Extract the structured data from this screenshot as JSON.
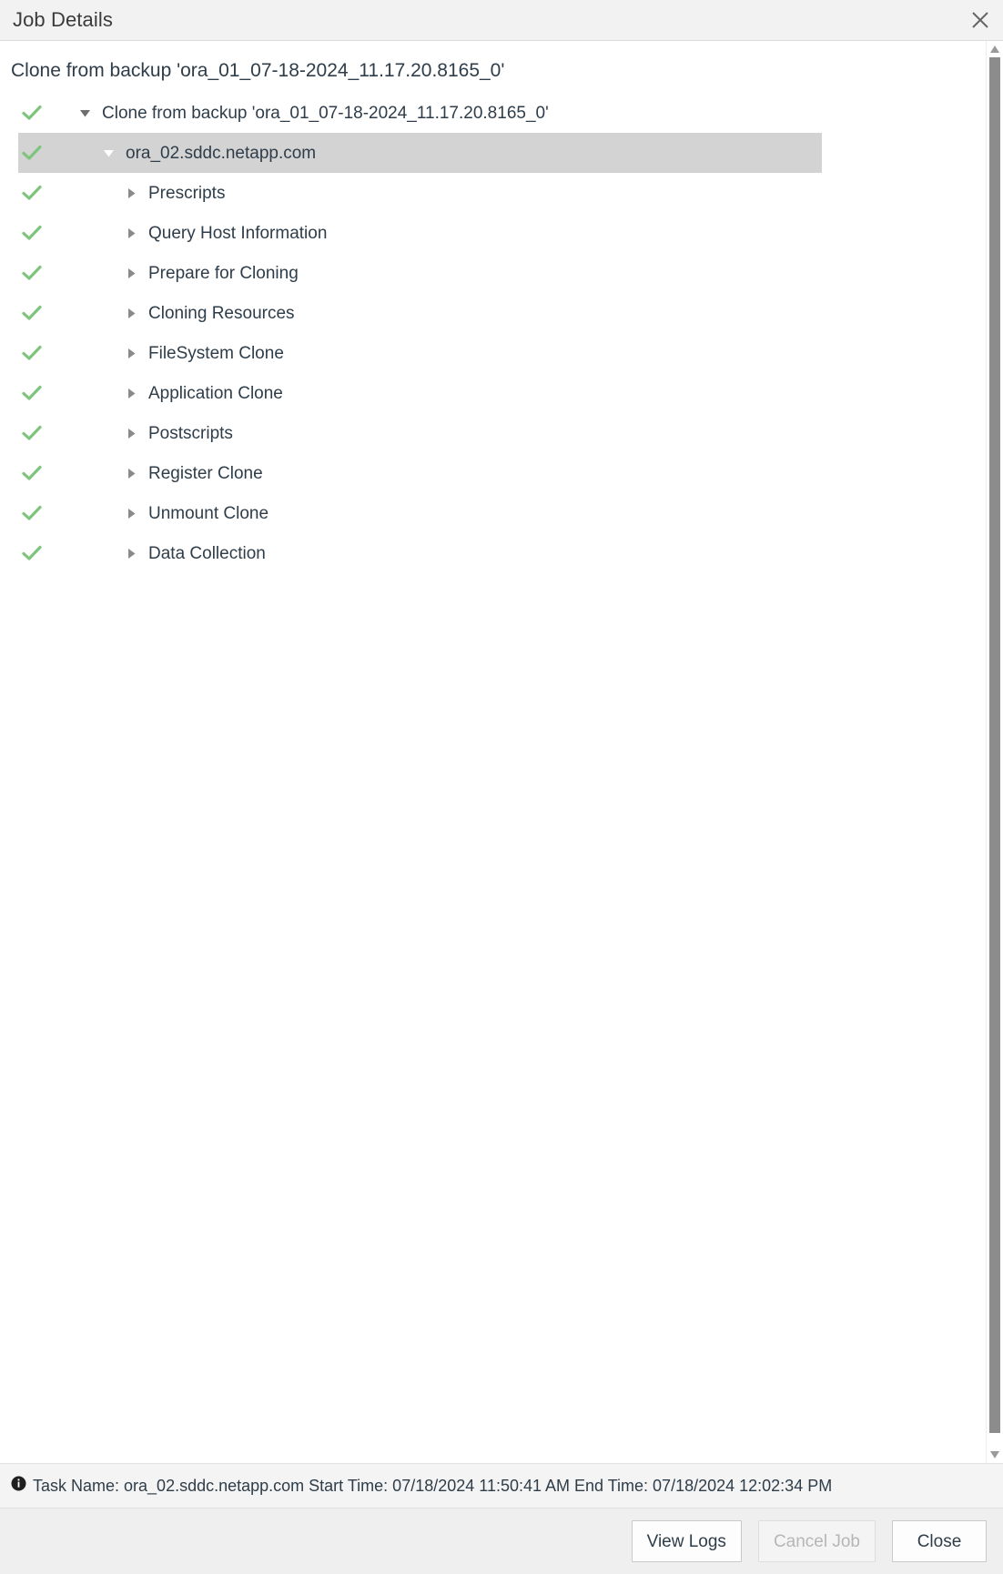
{
  "window": {
    "title": "Job Details",
    "close_icon": "close-icon"
  },
  "job": {
    "heading": "Clone from backup 'ora_01_07-18-2024_11.17.20.8165_0'"
  },
  "tree": {
    "rows": [
      {
        "label": "Clone from backup 'ora_01_07-18-2024_11.17.20.8165_0'",
        "level": 0,
        "status": "success",
        "status_icon": "check-icon",
        "twisty": "expanded",
        "twisty_icon": "chevron-down-icon",
        "selected": false
      },
      {
        "label": "ora_02.sddc.netapp.com",
        "level": 1,
        "status": "success",
        "status_icon": "check-icon",
        "twisty": "expanded",
        "twisty_icon": "chevron-down-icon",
        "selected": true
      },
      {
        "label": "Prescripts",
        "level": 2,
        "status": "success",
        "status_icon": "check-icon",
        "twisty": "collapsed",
        "twisty_icon": "chevron-right-icon",
        "selected": false
      },
      {
        "label": "Query Host Information",
        "level": 2,
        "status": "success",
        "status_icon": "check-icon",
        "twisty": "collapsed",
        "twisty_icon": "chevron-right-icon",
        "selected": false
      },
      {
        "label": "Prepare for Cloning",
        "level": 2,
        "status": "success",
        "status_icon": "check-icon",
        "twisty": "collapsed",
        "twisty_icon": "chevron-right-icon",
        "selected": false
      },
      {
        "label": "Cloning Resources",
        "level": 2,
        "status": "success",
        "status_icon": "check-icon",
        "twisty": "collapsed",
        "twisty_icon": "chevron-right-icon",
        "selected": false
      },
      {
        "label": "FileSystem Clone",
        "level": 2,
        "status": "success",
        "status_icon": "check-icon",
        "twisty": "collapsed",
        "twisty_icon": "chevron-right-icon",
        "selected": false
      },
      {
        "label": "Application Clone",
        "level": 2,
        "status": "success",
        "status_icon": "check-icon",
        "twisty": "collapsed",
        "twisty_icon": "chevron-right-icon",
        "selected": false
      },
      {
        "label": "Postscripts",
        "level": 2,
        "status": "success",
        "status_icon": "check-icon",
        "twisty": "collapsed",
        "twisty_icon": "chevron-right-icon",
        "selected": false
      },
      {
        "label": "Register Clone",
        "level": 2,
        "status": "success",
        "status_icon": "check-icon",
        "twisty": "collapsed",
        "twisty_icon": "chevron-right-icon",
        "selected": false
      },
      {
        "label": "Unmount Clone",
        "level": 2,
        "status": "success",
        "status_icon": "check-icon",
        "twisty": "collapsed",
        "twisty_icon": "chevron-right-icon",
        "selected": false
      },
      {
        "label": "Data Collection",
        "level": 2,
        "status": "success",
        "status_icon": "check-icon",
        "twisty": "collapsed",
        "twisty_icon": "chevron-right-icon",
        "selected": false
      }
    ]
  },
  "statusbar": {
    "icon": "info-icon",
    "text": "Task Name: ora_02.sddc.netapp.com Start Time: 07/18/2024 11:50:41 AM End Time: 07/18/2024 12:02:34 PM"
  },
  "footer": {
    "view_logs_label": "View Logs",
    "cancel_job_label": "Cancel Job",
    "close_label": "Close",
    "cancel_job_disabled": true
  },
  "scrollbar": {
    "up_arrow_icon": "scroll-up-arrow-icon",
    "down_arrow_icon": "scroll-down-arrow-icon"
  },
  "colors": {
    "success_green": "#7dc47d",
    "selection_gray": "#d3d3d3",
    "titlebar_gray": "#f2f2f2",
    "text": "#2e3d49"
  }
}
